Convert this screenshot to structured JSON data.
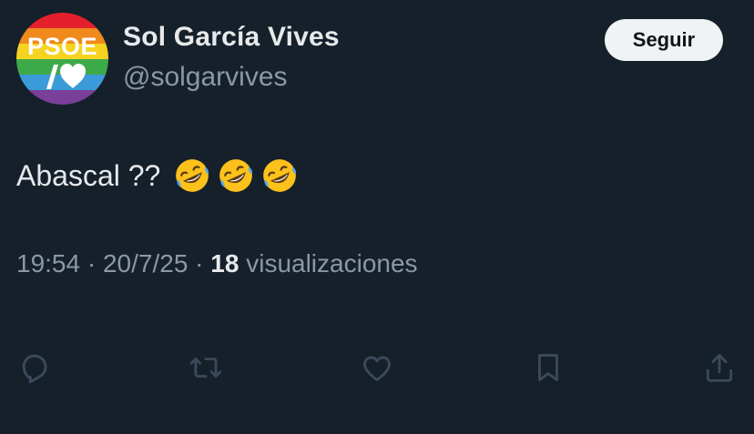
{
  "author": {
    "display_name": "Sol García Vives",
    "handle": "@solgarvives",
    "avatar_text": "PSOE",
    "avatar_icon": "slash-heart-logo"
  },
  "follow_button": {
    "label": "Seguir"
  },
  "tweet": {
    "text": "Abascal ??",
    "emojis": [
      "rolling-on-floor-laughing",
      "rolling-on-floor-laughing",
      "rolling-on-floor-laughing"
    ]
  },
  "meta": {
    "time": "19:54",
    "separator": "·",
    "date": "20/7/25",
    "views_count": "18",
    "views_label": "visualizaciones"
  },
  "actions": [
    {
      "name": "reply",
      "icon": "reply-icon"
    },
    {
      "name": "retweet",
      "icon": "retweet-icon"
    },
    {
      "name": "like",
      "icon": "heart-icon"
    },
    {
      "name": "bookmark",
      "icon": "bookmark-icon"
    },
    {
      "name": "share",
      "icon": "share-icon"
    }
  ],
  "colors": {
    "background": "#15202b",
    "primary_text": "#e7e9ea",
    "secondary_text": "#8b98a5",
    "follow_button_bg": "#eff3f4",
    "logo_red": "#e4202c"
  }
}
